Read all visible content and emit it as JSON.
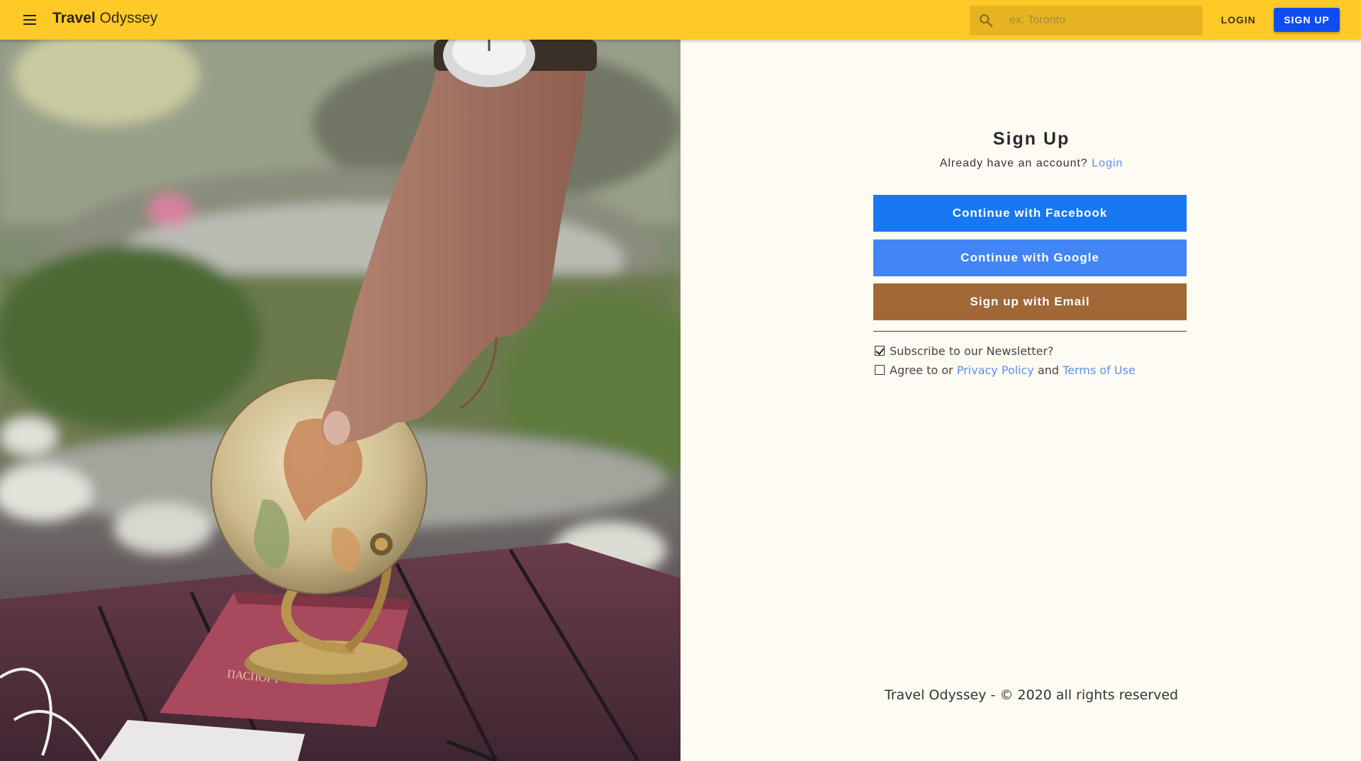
{
  "header": {
    "brand_bold": "Travel",
    "brand_light": "Odyssey",
    "search_placeholder": "ex. Toronto",
    "login_label": "LOGIN",
    "signup_label": "SIGN UP",
    "bar_color": "#ffc928",
    "signup_color": "#0f4cf2"
  },
  "signup": {
    "title": "Sign Up",
    "have_account_text": "Already have an account?",
    "login_link": "Login",
    "facebook_label": "Continue with Facebook",
    "google_label": "Continue with Google",
    "email_label": "Sign up with Email",
    "newsletter_label": "Subscribe to our Newsletter?",
    "newsletter_checked": true,
    "agree_prefix": "Agree to or",
    "privacy_link": "Privacy Policy",
    "agree_and": "and",
    "terms_link": "Terms of Use",
    "agree_checked": false,
    "facebook_color": "#1877f2",
    "google_color": "#4285f4",
    "email_color": "#a06737"
  },
  "footer": {
    "text": "Travel Odyssey - © 2020 all rights reserved"
  },
  "icons": {
    "menu": "menu-icon",
    "search": "search-icon"
  }
}
